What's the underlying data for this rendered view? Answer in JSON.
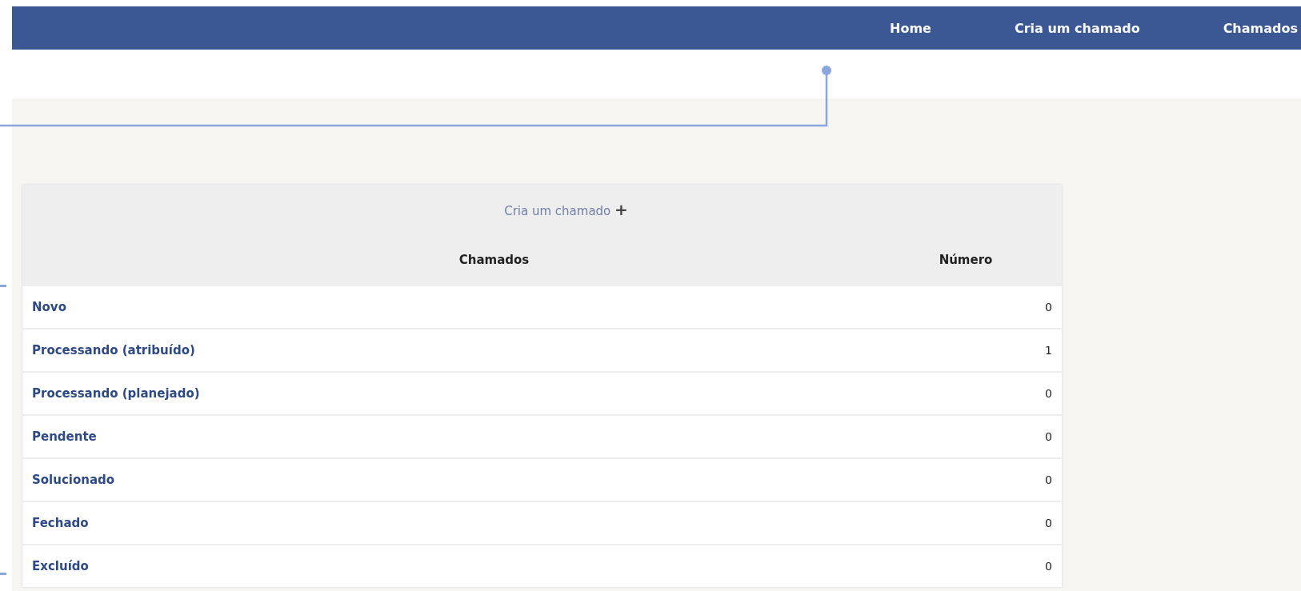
{
  "nav": {
    "items": [
      "Home",
      "Cria um chamado",
      "Chamados"
    ]
  },
  "table": {
    "action": "Cria um chamado",
    "action_icon": "+",
    "columns": [
      "Chamados",
      "Número"
    ],
    "rows": [
      {
        "status": "Novo",
        "count": "0"
      },
      {
        "status": "Processando (atribuído)",
        "count": "1"
      },
      {
        "status": "Processando (planejado)",
        "count": "0"
      },
      {
        "status": "Pendente",
        "count": "0"
      },
      {
        "status": "Solucionado",
        "count": "0"
      },
      {
        "status": "Fechado",
        "count": "0"
      },
      {
        "status": "Excluído",
        "count": "0"
      }
    ]
  }
}
